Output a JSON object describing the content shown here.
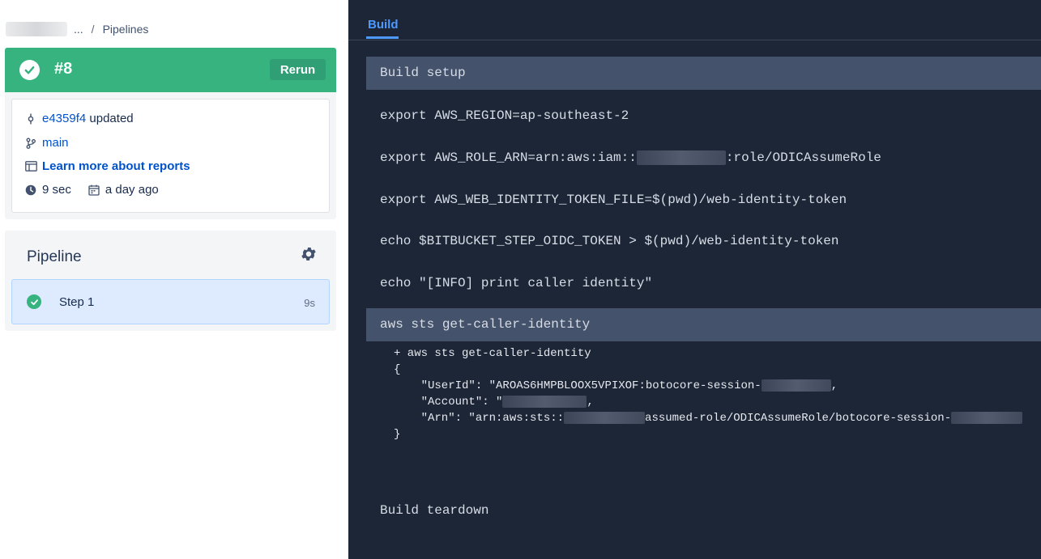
{
  "breadcrumb": {
    "ellipsis": "...",
    "separator": "/",
    "current": "Pipelines"
  },
  "build": {
    "number": "#8",
    "rerun_label": "Rerun",
    "status_color": "#36b37e",
    "commit_hash": "e4359f4",
    "commit_suffix": "updated",
    "branch": "main",
    "reports_link": "Learn more about reports",
    "duration": "9 sec",
    "date": "a day ago"
  },
  "pipeline": {
    "title": "Pipeline",
    "steps": [
      {
        "label": "Step 1",
        "duration": "9s",
        "status": "success"
      }
    ]
  },
  "log": {
    "tab": "Build",
    "build_setup": "Build setup",
    "commands": [
      "export AWS_REGION=ap-southeast-2",
      "export AWS_ROLE_ARN=arn:aws:iam::",
      ":role/ODICAssumeRole",
      "export AWS_WEB_IDENTITY_TOKEN_FILE=$(pwd)/web-identity-token",
      "echo $BITBUCKET_STEP_OIDC_TOKEN > $(pwd)/web-identity-token",
      "echo \"[INFO] print caller identity\""
    ],
    "sts_section": "aws sts get-caller-identity",
    "output": {
      "line1": "+ aws sts get-caller-identity",
      "open_brace": "{",
      "userid_prefix": "    \"UserId\": \"AROAS6HMPBLOOX5VPIXOF:botocore-session-",
      "userid_suffix": ",",
      "account_prefix": "    \"Account\": \"",
      "account_suffix": ",",
      "arn_prefix": "    \"Arn\": \"arn:aws:sts::",
      "arn_middle": "assumed-role/ODICAssumeRole/botocore-session-",
      "close_brace": "}"
    },
    "teardown": "Build teardown"
  }
}
